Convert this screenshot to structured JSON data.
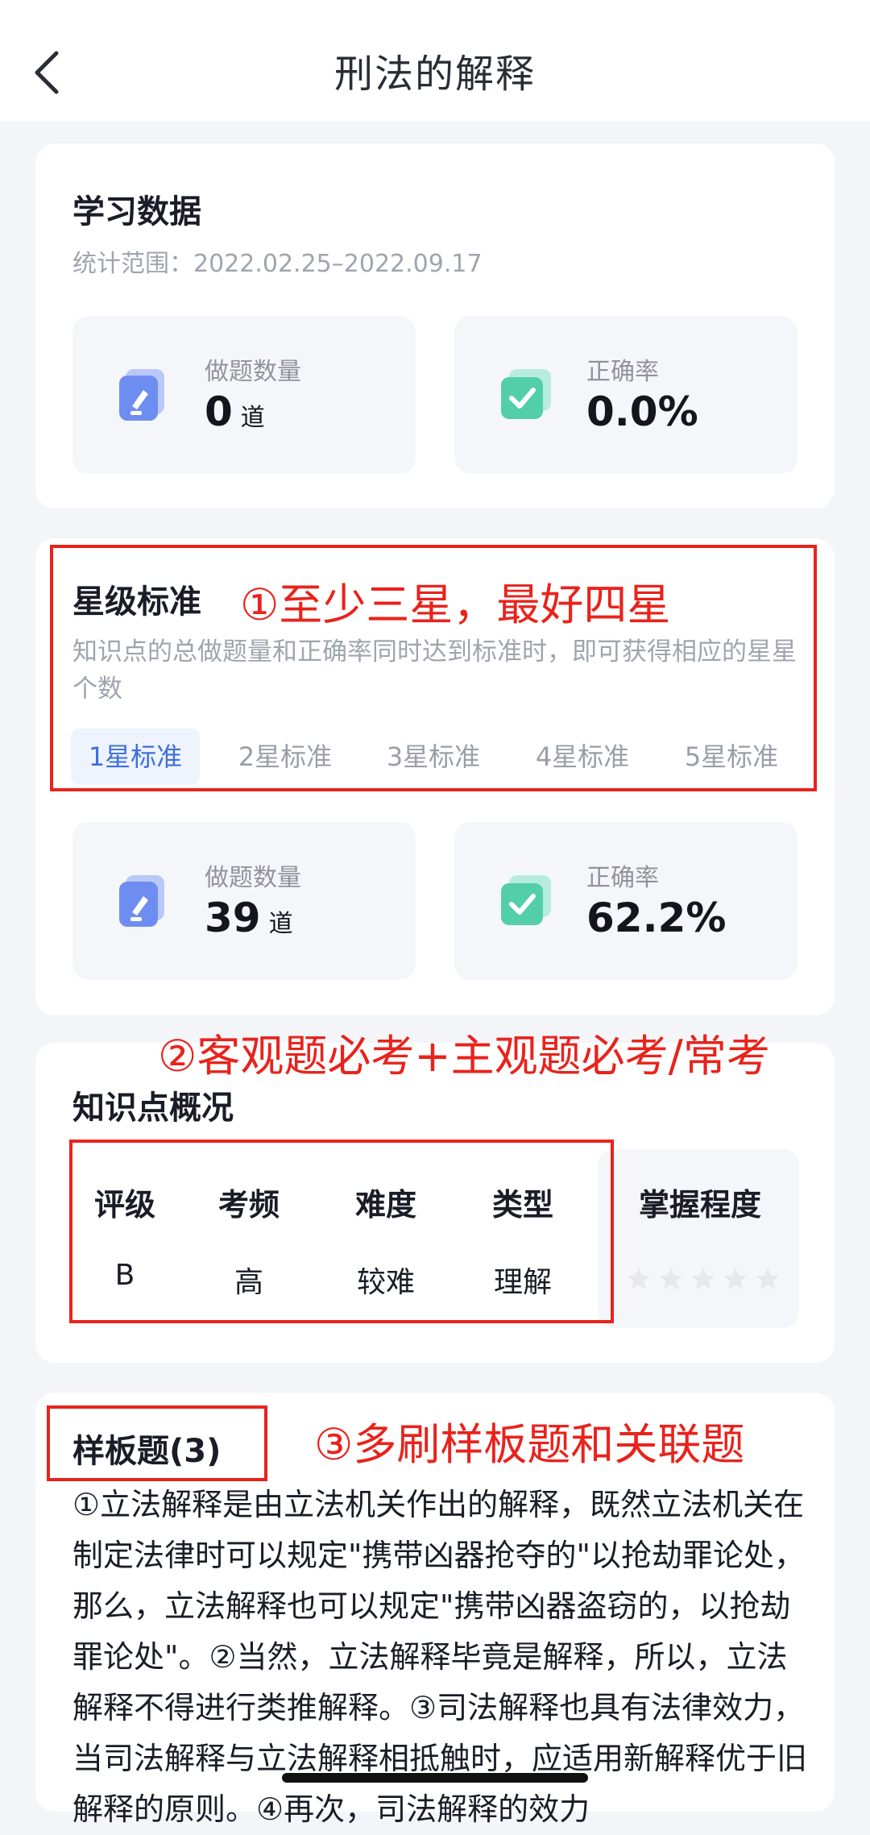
{
  "header": {
    "title": "刑法的解释",
    "back_icon": "chevron-left-icon"
  },
  "study": {
    "title": "学习数据",
    "range": "统计范围：2022.02.25–2022.09.17",
    "count_label": "做题数量",
    "count_value": "0",
    "count_unit": "道",
    "rate_label": "正确率",
    "rate_value": "0.0%"
  },
  "stars": {
    "title": "星级标准",
    "desc": "知识点的总做题量和正确率同时达到标准时，即可获得相应的星星个数",
    "tabs": [
      "1星标准",
      "2星标准",
      "3星标准",
      "4星标准",
      "5星标准"
    ],
    "active_tab": 0,
    "count_label": "做题数量",
    "count_value": "39",
    "count_unit": "道",
    "rate_label": "正确率",
    "rate_value": "62.2%"
  },
  "knowledge": {
    "title": "知识点概况",
    "headers": [
      "评级",
      "考频",
      "难度",
      "类型",
      "掌握程度"
    ],
    "values": [
      "B",
      "高",
      "较难",
      "理解"
    ],
    "mastery_stars": 0
  },
  "sample": {
    "title": "样板题(3)",
    "text": "①立法解释是由立法机关作出的解释，既然立法机关在制定法律时可以规定\"携带凶器抢夺的\"以抢劫罪论处，那么，立法解释也可以规定\"携带凶器盗窃的，以抢劫罪论处\"。②当然，立法解释毕竟是解释，所以，立法解释不得进行类推解释。③司法解释也具有法律效力，当司法解释与立法解释相抵触时，应适用新解释优于旧解释的原则。④再次，司法解释的效力"
  },
  "annotations": {
    "a1": "①至少三星，最好四星",
    "a2": "②客观题必考+主观题必考/常考",
    "a3": "③多刷样板题和关联题"
  },
  "colors": {
    "accent": "#3f6fd9",
    "annotation_red": "#e8231c",
    "icon_blue": "#6d8df0",
    "icon_green": "#52cfa7"
  }
}
